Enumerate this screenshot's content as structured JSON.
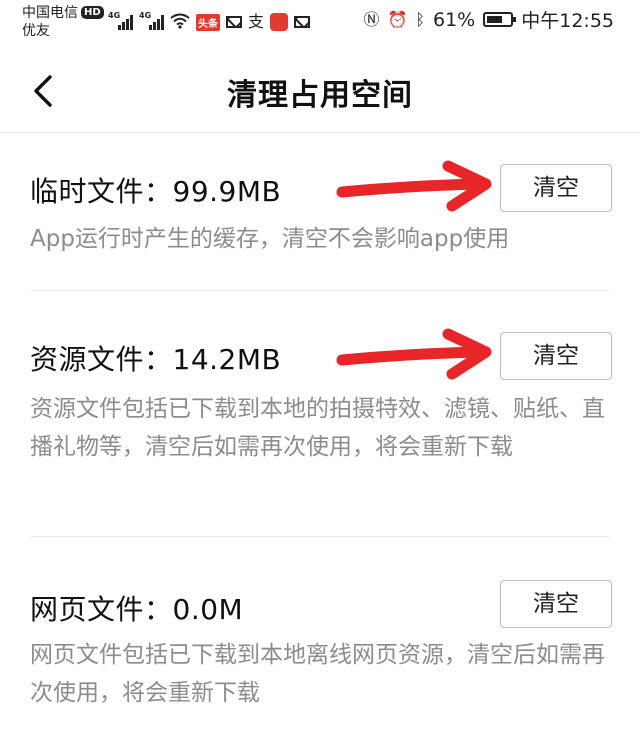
{
  "status_bar": {
    "carrier_line1": "中国电信",
    "carrier_line2": "优友",
    "hd_badge": "HD",
    "signal_tag_1": "4G",
    "signal_tag_2": "4G",
    "news_badge": "头条",
    "battery_percent": "61%",
    "time": "中午12:55"
  },
  "header": {
    "back_icon": "chevron-left-icon",
    "title": "清理占用空间"
  },
  "sections": [
    {
      "title": "临时文件：99.9MB",
      "description": "App运行时产生的缓存，清空不会影响app使用",
      "button_label": "清空"
    },
    {
      "title": "资源文件：14.2MB",
      "description": "资源文件包括已下载到本地的拍摄特效、滤镜、贴纸、直播礼物等，清空后如需再次使用，将会重新下载",
      "button_label": "清空"
    },
    {
      "title": "网页文件：0.0M",
      "description": "网页文件包括已下载到本地离线网页资源，清空后如需再次使用，将会重新下载",
      "button_label": "清空"
    }
  ],
  "annotations": {
    "arrow_color": "#e8262a"
  }
}
